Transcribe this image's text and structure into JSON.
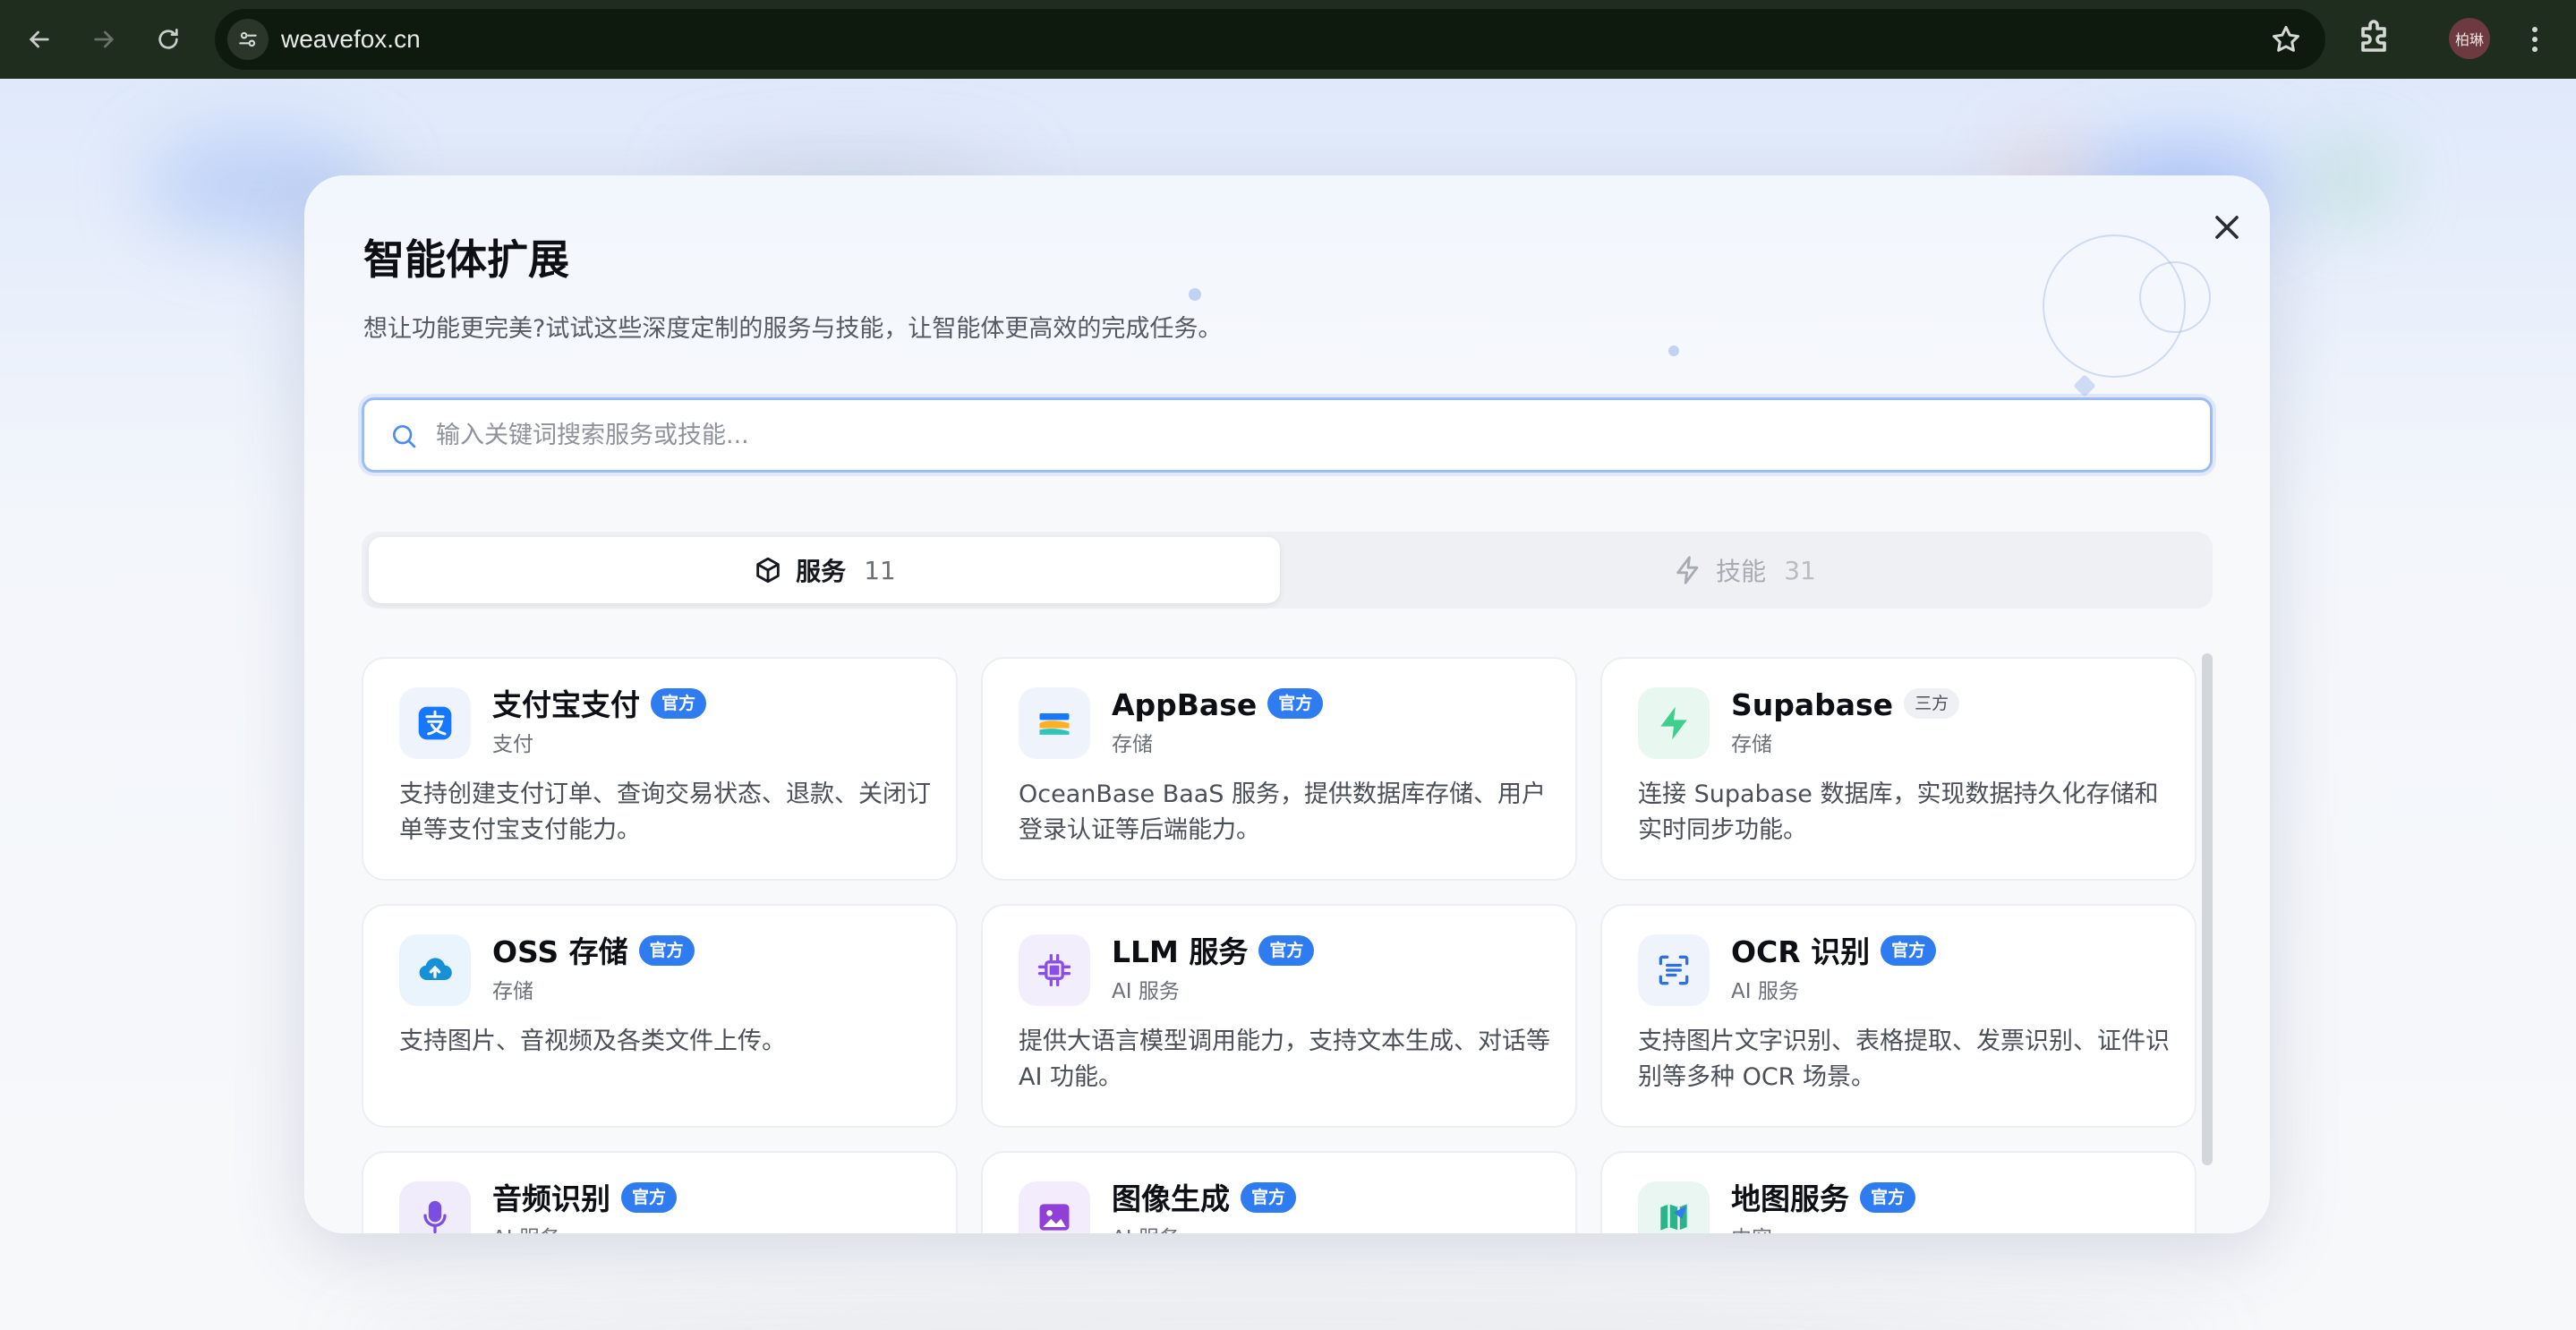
{
  "browser": {
    "url": "weavefox.cn",
    "profile_label": "柏琳"
  },
  "modal": {
    "title": "智能体扩展",
    "subtitle": "想让功能更完美?试试这些深度定制的服务与技能，让智能体更高效的完成任务。",
    "search_placeholder": "输入关键词搜索服务或技能...",
    "tabs": [
      {
        "label": "服务",
        "count": "11",
        "icon": "cube-icon",
        "active": true
      },
      {
        "label": "技能",
        "count": "31",
        "icon": "lightning-icon",
        "active": false
      }
    ],
    "cards": [
      {
        "name": "支付宝支付",
        "badge": "官方",
        "badge_type": "official",
        "category": "支付",
        "description": "支持创建支付订单、查询交易状态、退款、关闭订单等支付宝支付能力。",
        "icon": "alipay-icon",
        "icon_bg": "#eef3fc",
        "icon_color": "#1677ff"
      },
      {
        "name": "AppBase",
        "badge": "官方",
        "badge_type": "official",
        "category": "存储",
        "description": "OceanBase BaaS 服务，提供数据库存储、用户登录认证等后端能力。",
        "icon": "appbase-icon",
        "icon_bg": "#eef3fc",
        "icon_color": "#1677ff"
      },
      {
        "name": "Supabase",
        "badge": "三方",
        "badge_type": "third",
        "category": "存储",
        "description": "连接 Supabase 数据库，实现数据持久化存储和实时同步功能。",
        "icon": "supabase-icon",
        "icon_bg": "#e8f7ef",
        "icon_color": "#3ecf8e"
      },
      {
        "name": "OSS 存储",
        "badge": "官方",
        "badge_type": "official",
        "category": "存储",
        "description": "支持图片、音视频及各类文件上传。",
        "icon": "cloud-upload-icon",
        "icon_bg": "#e9f4fc",
        "icon_color": "#1890d8"
      },
      {
        "name": "LLM 服务",
        "badge": "官方",
        "badge_type": "official",
        "category": "AI 服务",
        "description": "提供大语言模型调用能力，支持文本生成、对话等 AI 功能。",
        "icon": "chip-icon",
        "icon_bg": "#f3eefc",
        "icon_color": "#8a4dea"
      },
      {
        "name": "OCR 识别",
        "badge": "官方",
        "badge_type": "official",
        "category": "AI 服务",
        "description": "支持图片文字识别、表格提取、发票识别、证件识别等多种 OCR 场景。",
        "icon": "scan-icon",
        "icon_bg": "#eef3fc",
        "icon_color": "#2f6fe0"
      },
      {
        "name": "音频识别",
        "badge": "官方",
        "badge_type": "official",
        "category": "AI 服务",
        "description": "",
        "icon": "microphone-icon",
        "icon_bg": "#f1ecfc",
        "icon_color": "#7b4de0"
      },
      {
        "name": "图像生成",
        "badge": "官方",
        "badge_type": "official",
        "category": "AI 服务",
        "description": "",
        "icon": "image-icon",
        "icon_bg": "#f3ecfc",
        "icon_color": "#9040d8"
      },
      {
        "name": "地图服务",
        "badge": "官方",
        "badge_type": "official",
        "category": "内容",
        "description": "",
        "icon": "map-icon",
        "icon_bg": "#e9f6f1",
        "icon_color": "#2bb38a"
      }
    ]
  }
}
